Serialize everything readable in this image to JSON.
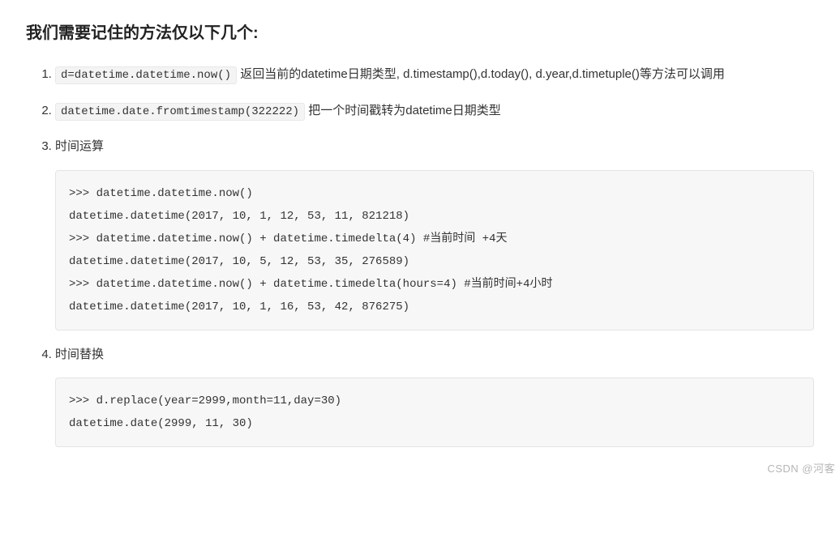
{
  "heading": "我们需要记住的方法仅以下几个:",
  "items": [
    {
      "code": "d=datetime.datetime.now()",
      "after": " 返回当前的datetime日期类型, d.timestamp(),d.today(), d.year,d.timetuple()等方法可以调用"
    },
    {
      "code": "datetime.date.fromtimestamp(322222)",
      "after": " 把一个时间戳转为datetime日期类型"
    },
    {
      "label": "时间运算",
      "block": ">>> datetime.datetime.now()\ndatetime.datetime(2017, 10, 1, 12, 53, 11, 821218)\n>>> datetime.datetime.now() + datetime.timedelta(4) #当前时间 +4天\ndatetime.datetime(2017, 10, 5, 12, 53, 35, 276589)\n>>> datetime.datetime.now() + datetime.timedelta(hours=4) #当前时间+4小时\ndatetime.datetime(2017, 10, 1, 16, 53, 42, 876275)"
    },
    {
      "label": "时间替换",
      "block": ">>> d.replace(year=2999,month=11,day=30)\ndatetime.date(2999, 11, 30)"
    }
  ],
  "watermark": "CSDN @河客"
}
